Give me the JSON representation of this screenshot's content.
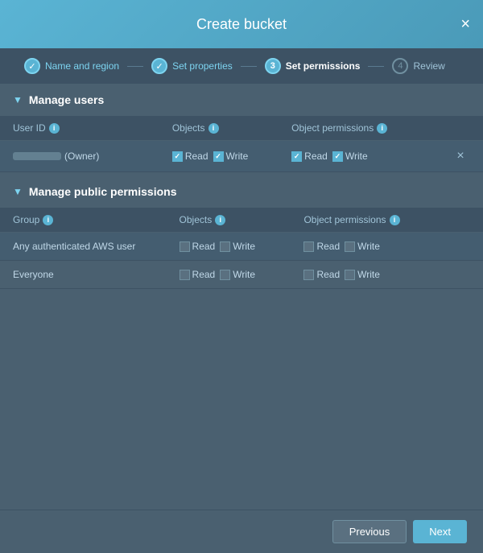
{
  "modal": {
    "title": "Create bucket",
    "close_label": "×"
  },
  "wizard": {
    "steps": [
      {
        "id": "name-region",
        "label": "Name and region",
        "type": "check",
        "active": false
      },
      {
        "id": "set-properties",
        "label": "Set properties",
        "type": "check",
        "active": false
      },
      {
        "id": "set-permissions",
        "label": "Set permissions",
        "number": "3",
        "type": "active",
        "active": true
      },
      {
        "id": "review",
        "label": "Review",
        "number": "4",
        "type": "inactive",
        "active": false
      }
    ]
  },
  "manage_users": {
    "section_title": "Manage users",
    "table_headers": {
      "user_id": "User ID",
      "objects": "Objects",
      "object_permissions": "Object permissions"
    },
    "rows": [
      {
        "user_id_blurred": true,
        "user_id_suffix": "(Owner)",
        "objects_read": true,
        "objects_write": true,
        "objperms_read": true,
        "objperms_write": true,
        "has_delete": true
      }
    ]
  },
  "manage_public": {
    "section_title": "Manage public permissions",
    "table_headers": {
      "group": "Group",
      "objects": "Objects",
      "object_permissions": "Object permissions"
    },
    "rows": [
      {
        "group": "Any authenticated AWS user",
        "objects_read": false,
        "objects_write": false,
        "objperms_read": false,
        "objperms_write": false
      },
      {
        "group": "Everyone",
        "objects_read": false,
        "objects_write": false,
        "objperms_read": false,
        "objperms_write": false
      }
    ]
  },
  "footer": {
    "previous_label": "Previous",
    "next_label": "Next"
  },
  "labels": {
    "read": "Read",
    "write": "Write",
    "owner_suffix": "(Owner)"
  }
}
